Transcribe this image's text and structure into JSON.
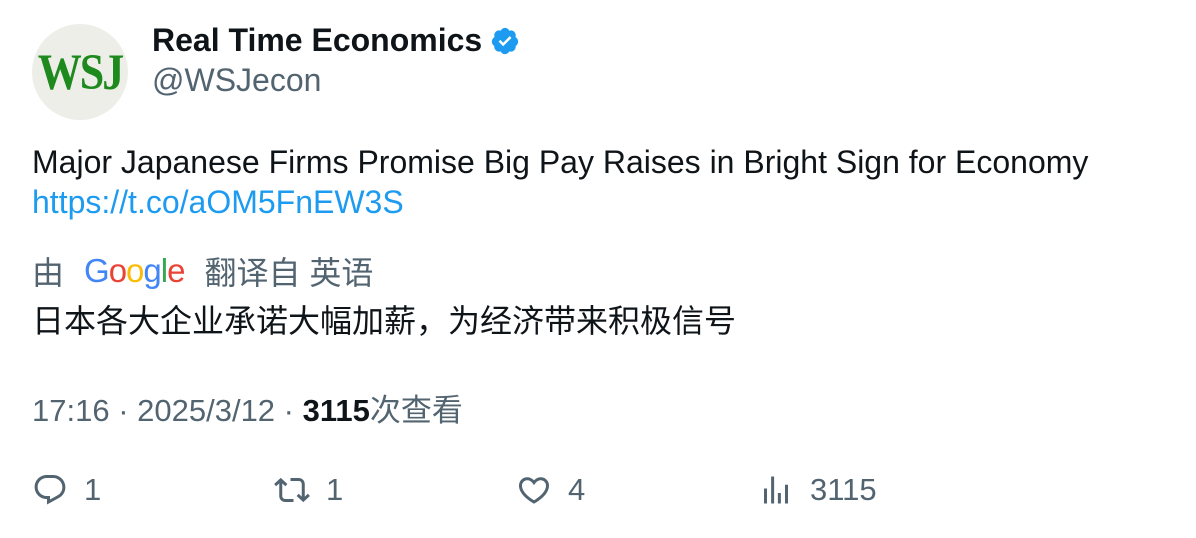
{
  "author": {
    "avatar_text": "WSJ",
    "name": "Real Time Economics",
    "handle": "@WSJecon",
    "verified": true
  },
  "tweet": {
    "text": "Major Japanese Firms Promise Big Pay Raises in Bright Sign for Economy",
    "link": "https://t.co/aOM5FnEW3S"
  },
  "translation": {
    "by_label": "由",
    "provider": "Google",
    "from_label": "翻译自 英语",
    "text": "日本各大企业承诺大幅加薪，为经济带来积极信号"
  },
  "meta": {
    "time": "17:16",
    "date": "2025/3/12",
    "views": "3115",
    "views_label": "次查看"
  },
  "actions": {
    "replies": "1",
    "retweets": "1",
    "likes": "4",
    "views": "3115"
  },
  "colors": {
    "link": "#1d9bf0",
    "secondary": "#536471",
    "primary": "#0f1419",
    "avatar_text": "#1e8a1e"
  }
}
